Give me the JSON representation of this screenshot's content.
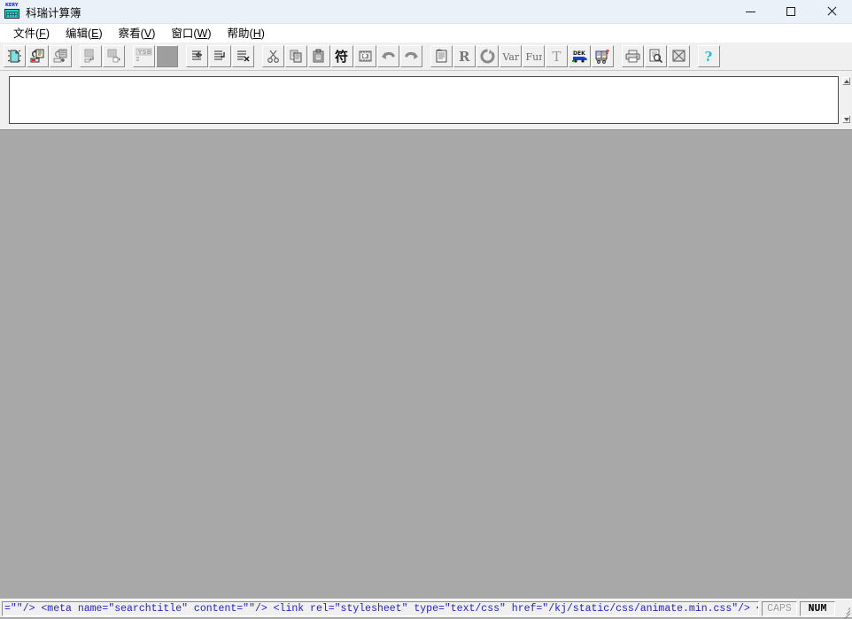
{
  "window": {
    "title": "科瑞计算簿",
    "icon": "calculator-app-icon",
    "icon_label": "KERY",
    "controls": {
      "minimize": "minimize-button",
      "maximize": "maximize-button",
      "close": "close-button"
    }
  },
  "menubar": {
    "items": [
      {
        "label": "文件(F)",
        "text": "文件(",
        "accel": "F",
        "tail": ")",
        "name": "menu-file"
      },
      {
        "label": "编辑(E)",
        "text": "编辑(",
        "accel": "E",
        "tail": ")",
        "name": "menu-edit"
      },
      {
        "label": "察看(V)",
        "text": "察看(",
        "accel": "V",
        "tail": ")",
        "name": "menu-view"
      },
      {
        "label": "窗口(W)",
        "text": "窗口(",
        "accel": "W",
        "tail": ")",
        "name": "menu-window"
      },
      {
        "label": "帮助(H)",
        "text": "帮助(",
        "accel": "H",
        "tail": ")",
        "name": "menu-help"
      }
    ]
  },
  "toolbar": {
    "groups": [
      {
        "buttons": [
          {
            "name": "new-document-icon",
            "icon": "new-document",
            "enabled": true
          },
          {
            "name": "open-document-icon",
            "icon": "open-document",
            "enabled": true
          },
          {
            "name": "save-document-icon",
            "icon": "save-document",
            "enabled": false
          }
        ]
      },
      {
        "buttons": [
          {
            "name": "import-sheet-icon",
            "icon": "import-sheet",
            "enabled": false
          },
          {
            "name": "export-sheet-icon",
            "icon": "export-sheet",
            "enabled": false
          }
        ]
      },
      {
        "buttons": [
          {
            "name": "ysb-button",
            "icon": "ysb-label",
            "label": "YSB",
            "enabled": false
          },
          {
            "name": "solid-block-button",
            "icon": "solid-block",
            "enabled": true
          }
        ]
      },
      {
        "buttons": [
          {
            "name": "insert-line-before-icon",
            "icon": "insert-line-before",
            "enabled": true
          },
          {
            "name": "insert-line-after-icon",
            "icon": "insert-line-after",
            "enabled": true
          },
          {
            "name": "delete-line-icon",
            "icon": "delete-line",
            "enabled": true
          }
        ]
      },
      {
        "buttons": [
          {
            "name": "cut-icon",
            "icon": "scissors",
            "enabled": true
          },
          {
            "name": "copy-icon",
            "icon": "copy-pages",
            "enabled": true
          },
          {
            "name": "paste-icon",
            "icon": "clipboard-paste",
            "enabled": true
          },
          {
            "name": "chinese-symbol-icon",
            "icon": "chinese-character",
            "label": "符",
            "enabled": true
          },
          {
            "name": "find-icon",
            "icon": "binoculars",
            "enabled": true
          },
          {
            "name": "undo-icon",
            "icon": "undo-arrow",
            "enabled": true
          },
          {
            "name": "redo-icon",
            "icon": "redo-arrow",
            "enabled": true
          }
        ]
      },
      {
        "buttons": [
          {
            "name": "properties-icon",
            "icon": "notepad",
            "enabled": true
          },
          {
            "name": "recalculate-icon",
            "icon": "letter-r",
            "label": "R",
            "enabled": true
          },
          {
            "name": "refresh-icon",
            "icon": "circular-arrow",
            "enabled": true
          },
          {
            "name": "variables-icon",
            "icon": "var-label",
            "label": "Var",
            "enabled": true
          },
          {
            "name": "functions-icon",
            "icon": "fun-label",
            "label": "Fun",
            "enabled": true
          },
          {
            "name": "text-tool-icon",
            "icon": "letter-t",
            "label": "T",
            "enabled": true
          },
          {
            "name": "dek-truck-icon",
            "icon": "dek-truck",
            "label": "DEK",
            "enabled": true
          },
          {
            "name": "book-cart-icon",
            "icon": "book-cart",
            "enabled": true
          }
        ]
      },
      {
        "buttons": [
          {
            "name": "print-icon",
            "icon": "printer",
            "enabled": true
          },
          {
            "name": "print-preview-icon",
            "icon": "print-preview",
            "enabled": true
          },
          {
            "name": "page-setup-icon",
            "icon": "page-crossed",
            "enabled": true
          }
        ]
      },
      {
        "buttons": [
          {
            "name": "help-icon",
            "icon": "question-mark",
            "label": "?",
            "enabled": true
          }
        ]
      }
    ]
  },
  "editor": {
    "value": "",
    "placeholder": "",
    "scroll_up": "scroll-up-arrow",
    "scroll_down": "scroll-down-arrow"
  },
  "workspace": {
    "background": "#a8a8a8",
    "content": ""
  },
  "statusbar": {
    "message": "=\"\"/>        <meta name=\"searchtitle\" content=\"\"/>        <link rel=\"stylesheet\" type=\"text/css\" href=\"/kj/static/css/animate.min.css\"/>        <link rel=\"",
    "caps": "CAPS",
    "num": "NUM",
    "caps_active": false,
    "num_active": true
  },
  "colors": {
    "titlebar": "#eaf1f8",
    "toolbar_face": "#f0f0f0",
    "workspace": "#a8a8a8",
    "status_text": "#2222cc",
    "icon_accent": "#33cccc",
    "truck_blue": "#1a3fd6"
  }
}
